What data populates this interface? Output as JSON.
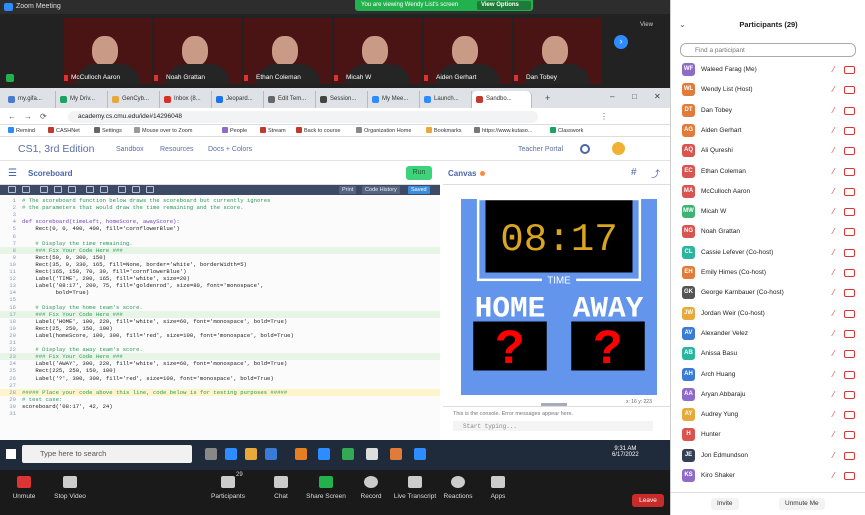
{
  "zoom": {
    "window_title": "Zoom Meeting",
    "viewing_banner": "You are viewing Wendy List's screen",
    "view_options": "View Options",
    "view_label": "View",
    "video_tiles": [
      {
        "name": "McCulloch Aaron"
      },
      {
        "name": "Noah Grattan"
      },
      {
        "name": "Ethan Coleman"
      },
      {
        "name": "Micah W"
      },
      {
        "name": "Aiden Gerhart"
      },
      {
        "name": "Dan Tobey"
      }
    ],
    "controls": [
      {
        "label": "Unmute",
        "icon": "microphone-muted-icon"
      },
      {
        "label": "Stop Video",
        "icon": "video-camera-icon"
      },
      {
        "label": "Participants",
        "icon": "participants-icon",
        "count": "29"
      },
      {
        "label": "Chat",
        "icon": "chat-icon"
      },
      {
        "label": "Share Screen",
        "icon": "share-screen-icon"
      },
      {
        "label": "Record",
        "icon": "record-icon"
      },
      {
        "label": "Live Transcript",
        "icon": "cc-icon"
      },
      {
        "label": "Reactions",
        "icon": "reactions-icon"
      },
      {
        "label": "Apps",
        "icon": "apps-icon"
      }
    ],
    "leave_label": "Leave"
  },
  "browser": {
    "tabs": [
      {
        "label": "my.gifa..."
      },
      {
        "label": "My Driv..."
      },
      {
        "label": "GenCyb..."
      },
      {
        "label": "Inbox (8..."
      },
      {
        "label": "Jeopard..."
      },
      {
        "label": "Edit Tem..."
      },
      {
        "label": "Session..."
      },
      {
        "label": "My Mee..."
      },
      {
        "label": "Launch..."
      },
      {
        "label": "Sandbo..."
      }
    ],
    "url": "academy.cs.cmu.edu/ide#14296048",
    "bookmarks": [
      "Remind",
      "CASHNet",
      "Settings",
      "Mouse over to Zoom",
      "People",
      "Stream",
      "Back to course",
      "Organization Home",
      "Bookmarks",
      "https://www.kutaso...",
      "Classwork"
    ]
  },
  "cmu": {
    "brand": "CS1, 3rd Edition",
    "nav": [
      "Sandbox",
      "Resources",
      "Docs + Colors"
    ],
    "teacher_portal": "Teacher Portal",
    "editor_title": "Scoreboard",
    "run_label": "Run",
    "toolbar_buttons": [
      "Print",
      "Code History"
    ],
    "saved_label": "Saved",
    "canvas_title": "Canvas",
    "coords": "x: 16  y: 223",
    "console_msg": "This is the console. Error messages appear here.",
    "console_placeholder": "Start typing...",
    "code_lines": [
      "# The scoreboard function below draws the scoreboard but currently ignores",
      "# the parameters that would draw the time remaining and the score.",
      "",
      "def scoreboard(timeLeft, homeScore, awayScore):",
      "    Rect(0, 0, 400, 400, fill='cornflowerBlue')",
      "",
      "    # Display the time remaining.",
      "    ### Fix Your Code Here ###",
      "    Rect(50, 0, 300, 150)",
      "    Rect(35, 0, 330, 165, fill=None, border='white', borderWidth=5)",
      "    Rect(165, 150, 70, 30, fill='cornflowerBlue')",
      "    Label('TIME', 200, 165, fill='white', size=20)",
      "    Label('08:17', 200, 75, fill='goldenrod', size=80, font='monospace',",
      "          bold=True)",
      "",
      "    # Display the home team's score.",
      "    ### Fix Your Code Here ###",
      "    Label('HOME', 100, 220, fill='white', size=60, font='monospace', bold=True)",
      "    Rect(25, 250, 150, 100)",
      "    Label(homeScore, 100, 300, fill='red', size=100, font='monospace', bold=True)",
      "",
      "    # Display the away team's score.",
      "    ### Fix Your Code Here ###",
      "    Label('AWAY', 300, 220, fill='white', size=60, font='monospace', bold=True)",
      "    Rect(225, 250, 150, 100)",
      "    Label('?', 300, 300, fill='red', size=100, font='monospace', bold=True)",
      "",
      "##### Place your code above this line, code below is for testing purposes #####",
      "# test case:",
      "scoreboard('08:17', 42, 24)",
      ""
    ],
    "canvas": {
      "time": "08:17",
      "time_label": "TIME",
      "home_label": "HOME",
      "away_label": "AWAY",
      "home_score": "?",
      "away_score": "?"
    }
  },
  "taskbar": {
    "search_placeholder": "Type here to search",
    "time": "9:31 AM",
    "date": "6/17/2022"
  },
  "participants": {
    "title": "Participants (29)",
    "find_placeholder": "Find a participant",
    "list": [
      {
        "initials": "WF",
        "name": "Waleed Farag (Me)",
        "color": "#8e6bc9"
      },
      {
        "initials": "WL",
        "name": "Wendy List (Host)",
        "color": "#e07b39"
      },
      {
        "initials": "DT",
        "name": "Dan Tobey",
        "color": "#e07b39"
      },
      {
        "initials": "AG",
        "name": "Aiden Gerhart",
        "color": "#e07b39"
      },
      {
        "initials": "AQ",
        "name": "Ali Qureshi",
        "color": "#d9534f"
      },
      {
        "initials": "EC",
        "name": "Ethan Coleman",
        "color": "#d9534f"
      },
      {
        "initials": "MA",
        "name": "McCulloch Aaron",
        "color": "#d9534f"
      },
      {
        "initials": "MW",
        "name": "Micah W",
        "color": "#3cb371"
      },
      {
        "initials": "NG",
        "name": "Noah Grattan",
        "color": "#d9534f"
      },
      {
        "initials": "CL",
        "name": "Cassie Lefever (Co-host)",
        "color": "#2bb5a0"
      },
      {
        "initials": "EH",
        "name": "Emily Himes (Co-host)",
        "color": "#e07b39"
      },
      {
        "initials": "GK",
        "name": "George Karnbauer (Co-host)",
        "color": "#555555"
      },
      {
        "initials": "JW",
        "name": "Jordan Weir (Co-host)",
        "color": "#e6a93a"
      },
      {
        "initials": "AV",
        "name": "Alexander Velez",
        "color": "#3a7bd5"
      },
      {
        "initials": "AB",
        "name": "Anissa Basu",
        "color": "#2bb5a0"
      },
      {
        "initials": "AH",
        "name": "Arch Huang",
        "color": "#3a7bd5"
      },
      {
        "initials": "AA",
        "name": "Aryan Abbaraju",
        "color": "#8e6bc9"
      },
      {
        "initials": "AY",
        "name": "Audrey Yung",
        "color": "#e6a93a"
      },
      {
        "initials": "H",
        "name": "Hunter",
        "color": "#d9534f"
      },
      {
        "initials": "JE",
        "name": "Jon Edmundson",
        "color": "#333f55"
      },
      {
        "initials": "KS",
        "name": "Kiro Shaker",
        "color": "#8e6bc9"
      }
    ],
    "invite_label": "Invite",
    "mute_me_label": "Unmute Me"
  }
}
